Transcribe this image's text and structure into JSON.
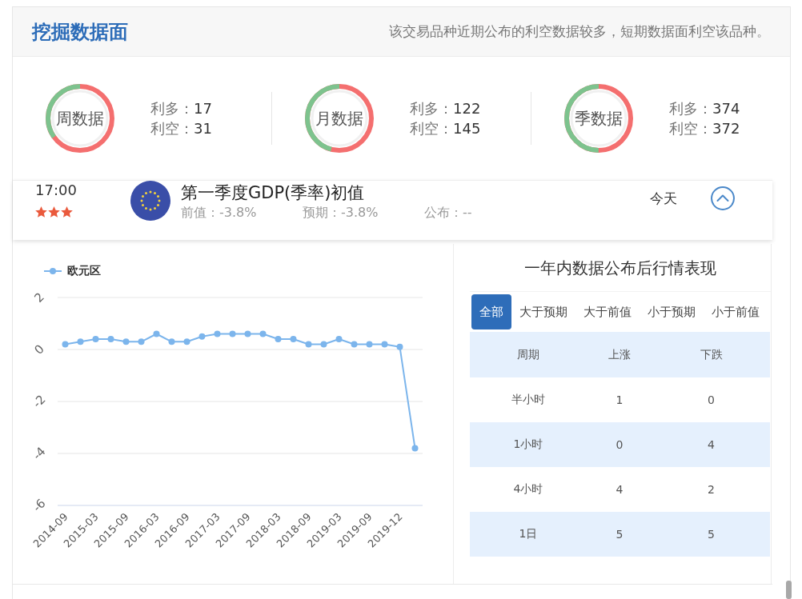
{
  "header": {
    "title": "挖掘数据面",
    "summary": "该交易品种近期公布的利空数据较多，短期数据面利空该品种。"
  },
  "stats": [
    {
      "name": "周数据",
      "level": 0.35,
      "items": [
        {
          "label": "利多：",
          "value": "17"
        },
        {
          "label": "利空：",
          "value": "31"
        }
      ]
    },
    {
      "name": "月数据",
      "level": 0.46,
      "items": [
        {
          "label": "利多：",
          "value": "122"
        },
        {
          "label": "利空：",
          "value": "145"
        }
      ]
    },
    {
      "name": "季数据",
      "level": 0.5,
      "items": [
        {
          "label": "利多：",
          "value": "374"
        },
        {
          "label": "利空：",
          "value": "372"
        }
      ]
    }
  ],
  "event": {
    "time": "17:00",
    "stars": 3,
    "title": "第一季度GDP(季率)初值",
    "details": [
      "前值：-3.8%",
      "预期：-3.8%",
      "公布：--"
    ],
    "day": "今天",
    "expanded": true
  },
  "chart": {
    "chart_data": {
      "type": "line",
      "categories": [
        "2014-09",
        null,
        "2015-03",
        null,
        "2015-09",
        null,
        "2016-03",
        null,
        "2016-09",
        null,
        "2017-03",
        null,
        "2017-09",
        null,
        "2018-03",
        null,
        "2018-09",
        null,
        "2019-03",
        null,
        "2019-09",
        null,
        "2019-12",
        null
      ],
      "ylim": [
        -6,
        2
      ],
      "yticks": [
        2,
        0,
        -2,
        -4,
        -6
      ],
      "grid": true,
      "series": [
        {
          "name": "欧元区",
          "color": "#7cb5ec",
          "marker": true,
          "values": [
            0.2,
            0.3,
            0.4,
            0.4,
            0.3,
            0.3,
            0.6,
            0.3,
            0.3,
            0.5,
            0.6,
            0.6,
            0.6,
            0.6,
            0.4,
            0.4,
            0.2,
            0.2,
            0.4,
            0.2,
            0.2,
            0.2,
            0.1,
            -3.8
          ]
        }
      ]
    }
  },
  "performance": {
    "title": "一年内数据公布后行情表现",
    "tabs": [
      {
        "label": "全部",
        "selected": true
      },
      {
        "label": "大于预期",
        "selected": false
      },
      {
        "label": "大于前值",
        "selected": false
      },
      {
        "label": "小于预期",
        "selected": false
      },
      {
        "label": "小于前值",
        "selected": false
      }
    ],
    "columns": [
      "周期",
      "上涨",
      "下跌"
    ],
    "rows": [
      [
        "半小时",
        "1",
        "0"
      ],
      [
        "1小时",
        "0",
        "4"
      ],
      [
        "4小时",
        "4",
        "2"
      ],
      [
        "1日",
        "5",
        "5"
      ]
    ]
  }
}
